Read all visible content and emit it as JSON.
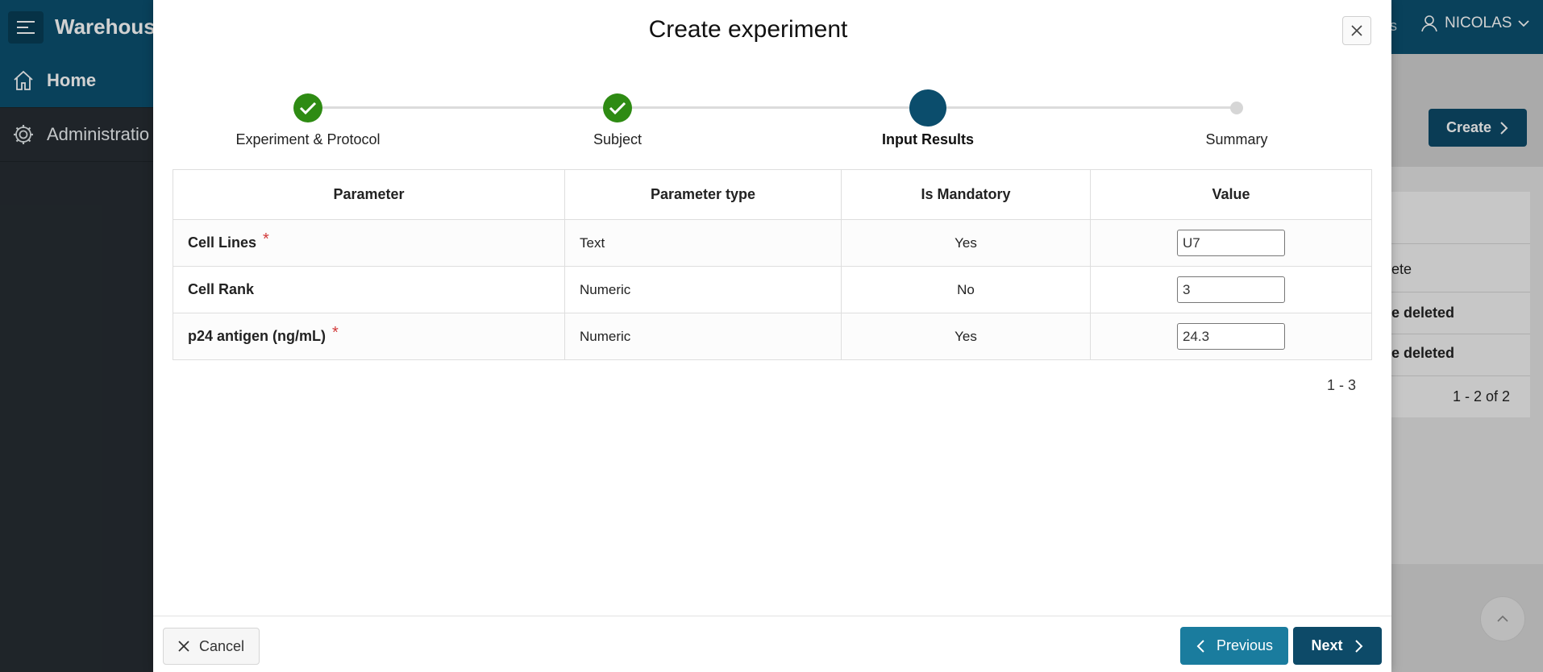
{
  "app": {
    "title": "Warehous",
    "header_apps_fragment": "os",
    "user_name": "NICOLAS"
  },
  "sidebar": {
    "items": [
      {
        "label": "Home",
        "icon": "home-icon",
        "active": true
      },
      {
        "label": "Administratio",
        "icon": "gear-icon",
        "active": false
      }
    ]
  },
  "background": {
    "create_label": "Create",
    "table_rows": [
      "ete",
      "e deleted",
      "e deleted"
    ],
    "pagination": "1 - 2 of 2"
  },
  "modal": {
    "title": "Create experiment",
    "steps": [
      {
        "label": "Experiment & Protocol",
        "state": "done"
      },
      {
        "label": "Subject",
        "state": "done"
      },
      {
        "label": "Input Results",
        "state": "current"
      },
      {
        "label": "Summary",
        "state": "todo"
      }
    ],
    "table": {
      "headers": [
        "Parameter",
        "Parameter type",
        "Is Mandatory",
        "Value"
      ],
      "rows": [
        {
          "parameter": "Cell Lines",
          "required_mark": "*",
          "type": "Text",
          "mandatory": "Yes",
          "value": "U7"
        },
        {
          "parameter": "Cell Rank",
          "required_mark": "",
          "type": "Numeric",
          "mandatory": "No",
          "value": "3"
        },
        {
          "parameter": "p24 antigen (ng/mL)",
          "required_mark": "*",
          "type": "Numeric",
          "mandatory": "Yes",
          "value": "24.3"
        }
      ]
    },
    "pagination": "1 - 3",
    "footer": {
      "cancel_label": "Cancel",
      "previous_label": "Previous",
      "next_label": "Next"
    }
  },
  "colors": {
    "header": "#0b5070",
    "sidebar": "#262d32",
    "step_done": "#2e8b13",
    "step_current": "#0b4d6c",
    "required": "#d23a3a",
    "btn_previous": "#1a7c9e",
    "btn_next": "#0d4a68"
  }
}
